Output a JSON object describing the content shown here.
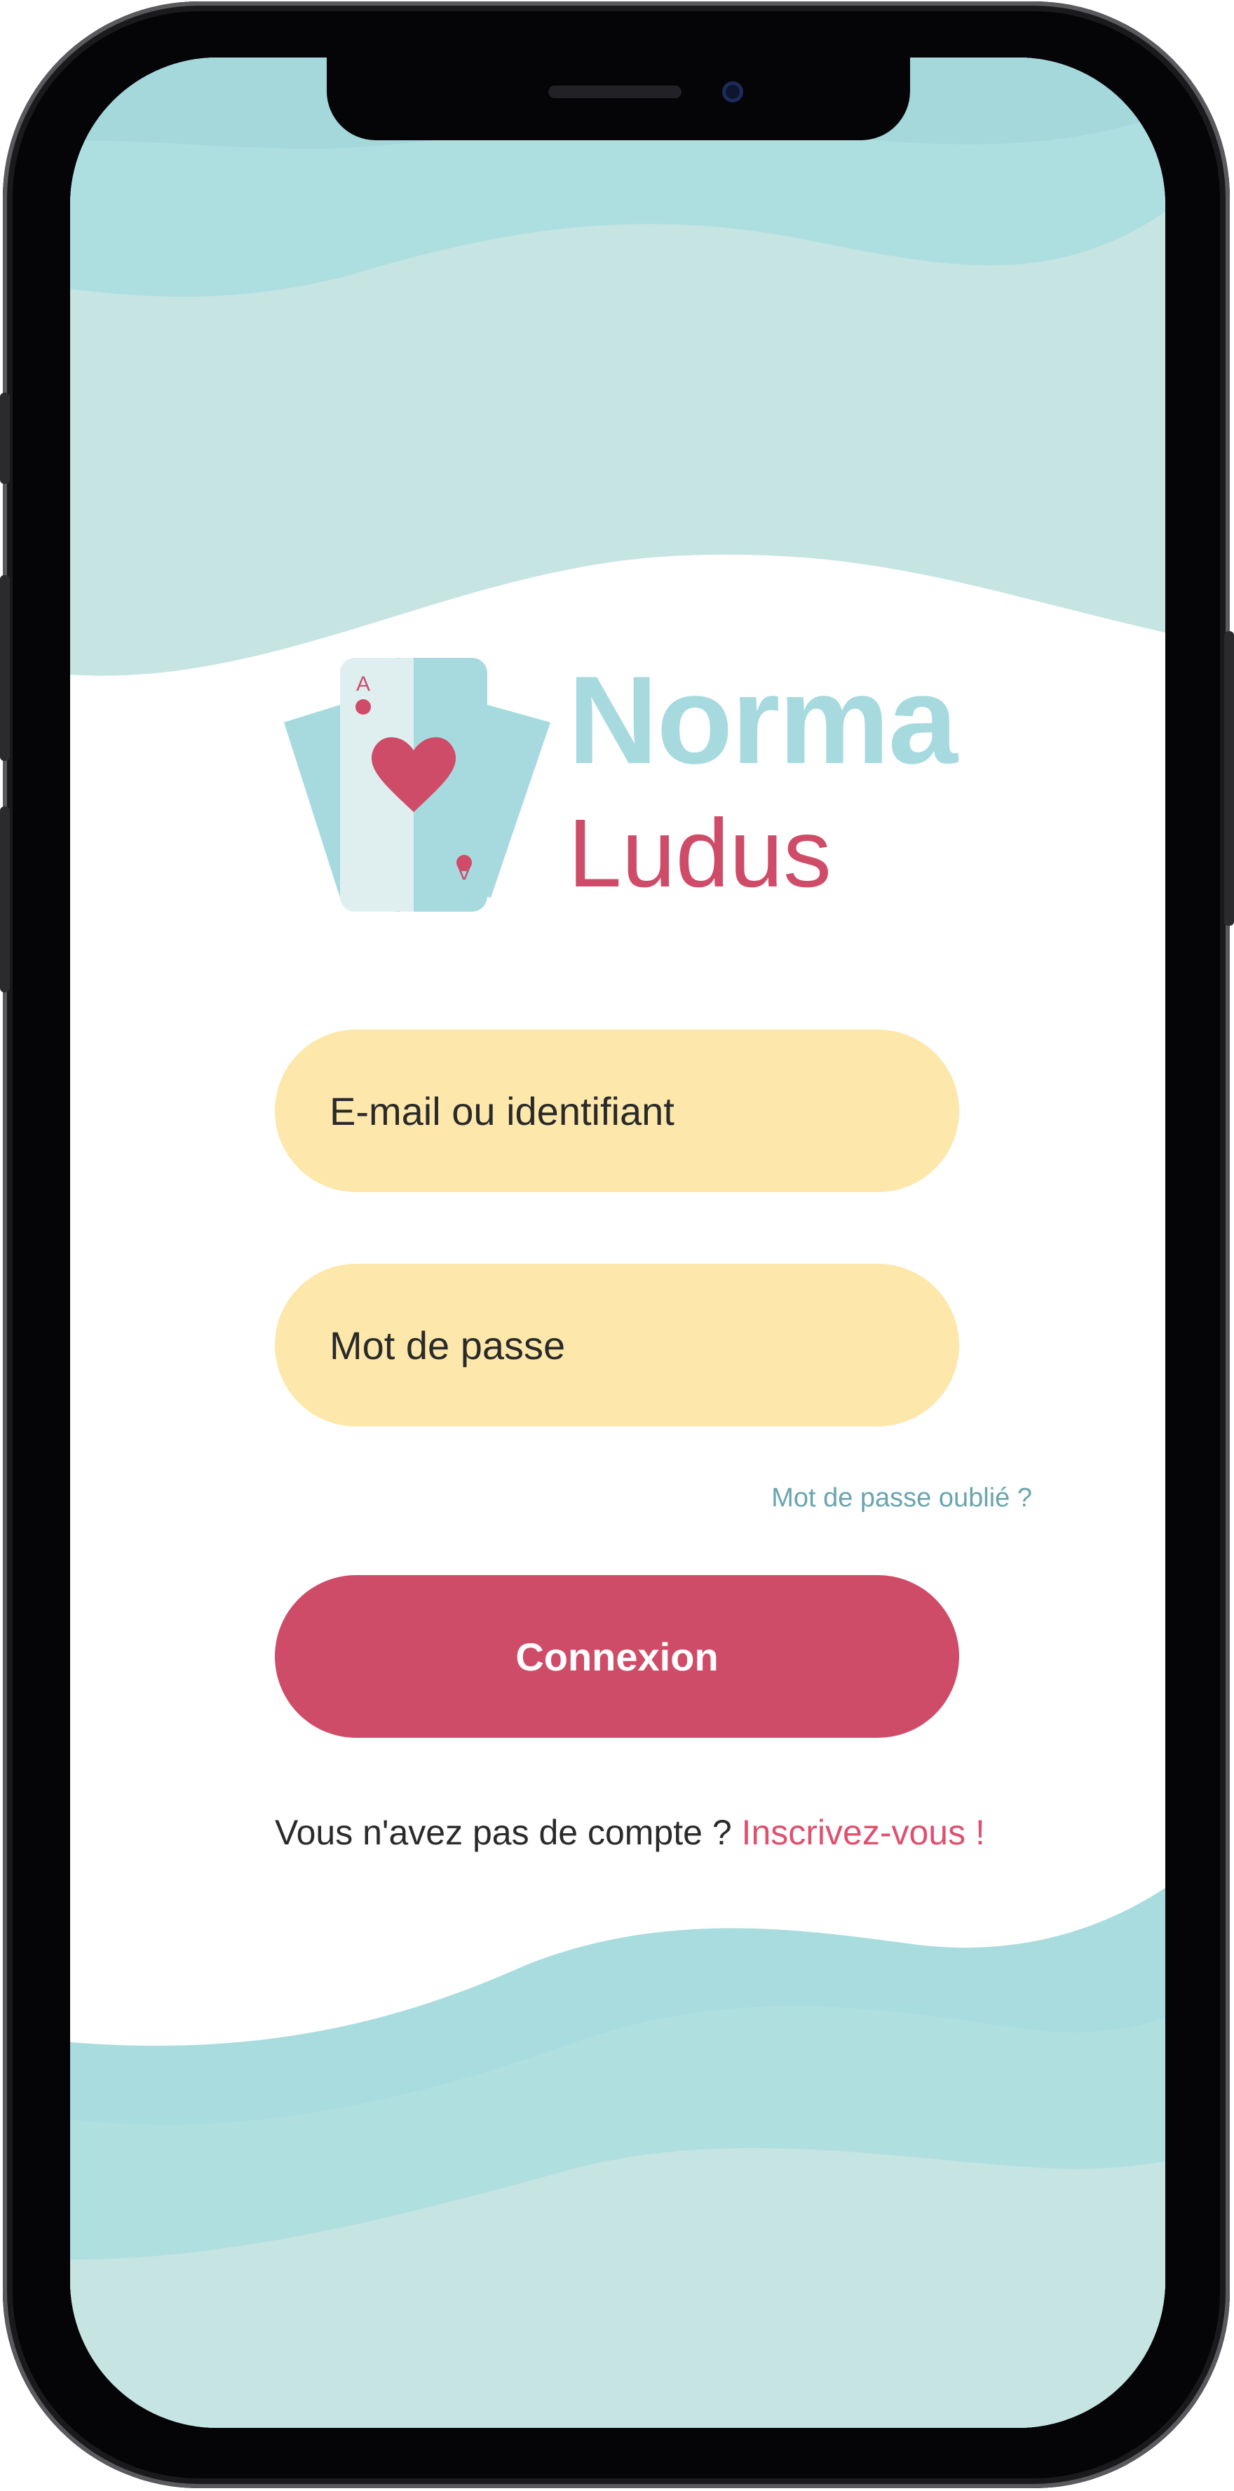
{
  "app": {
    "logo_line_1": "Norma",
    "logo_line_2": "Ludus",
    "card_rank": "A"
  },
  "login_form": {
    "email_placeholder": "E-mail ou identifiant",
    "password_placeholder": "Mot de passe",
    "forgot_password_link": "Mot de passe oublié ?",
    "submit_label": "Connexion",
    "no_account_text": "Vous n'avez pas de compte ?",
    "signup_link": "Inscrivez-vous !"
  },
  "colors": {
    "wave_light": "#c5e4e2",
    "wave_mid": "#aedfe0",
    "wave_dark": "#a4d8db",
    "input_background": "#fde7ab",
    "accent_pink": "#cf4c68",
    "logo_teal": "#a6dadf",
    "link_teal": "#6aa5ae"
  },
  "icons": {
    "logo": "playing-cards-ace-of-hearts-icon"
  }
}
